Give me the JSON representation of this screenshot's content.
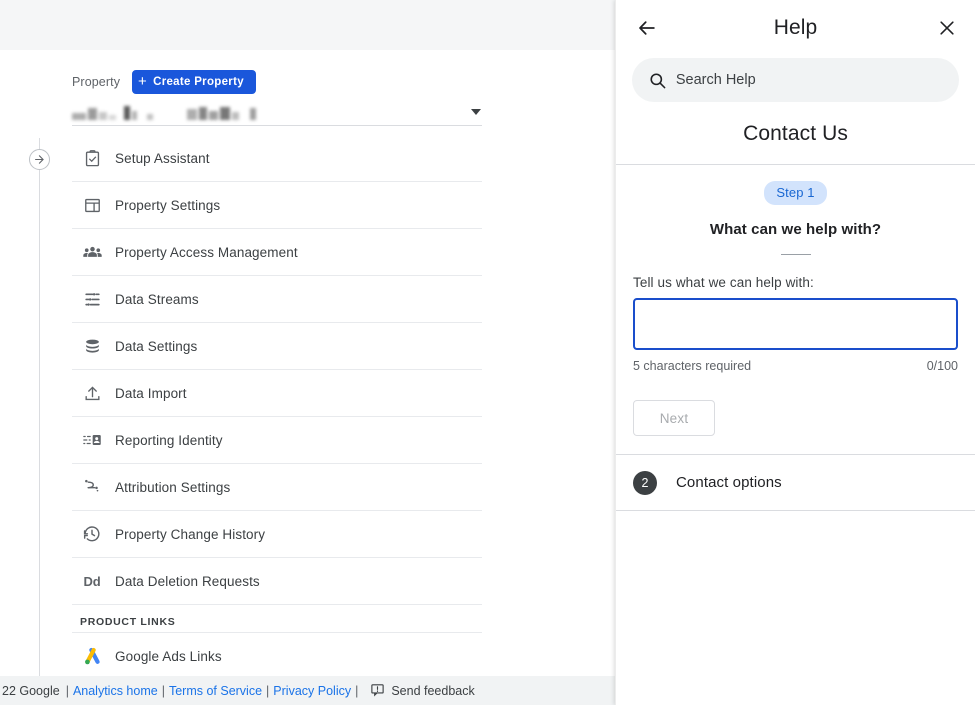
{
  "app": {
    "property_label": "Property",
    "create_property_button": "Create Property",
    "property_selector_value": "",
    "rail_toggle_icon": "arrow-right-circle-icon",
    "menu_items": [
      {
        "label": "Setup Assistant",
        "icon": "clipboard-check-icon"
      },
      {
        "label": "Property Settings",
        "icon": "layout-panel-icon"
      },
      {
        "label": "Property Access Management",
        "icon": "people-group-icon"
      },
      {
        "label": "Data Streams",
        "icon": "tune-sliders-icon"
      },
      {
        "label": "Data Settings",
        "icon": "database-stack-icon"
      },
      {
        "label": "Data Import",
        "icon": "upload-icon"
      },
      {
        "label": "Reporting Identity",
        "icon": "reporting-identity-icon"
      },
      {
        "label": "Attribution Settings",
        "icon": "attribution-path-icon"
      },
      {
        "label": "Property Change History",
        "icon": "history-clock-icon"
      },
      {
        "label": "Data Deletion Requests",
        "icon": "dd-text-icon"
      }
    ],
    "section_heading": "PRODUCT LINKS",
    "product_links": [
      {
        "label": "Google Ads Links",
        "icon": "google-ads-icon"
      }
    ],
    "footer": {
      "copyright": "22 Google",
      "links": [
        {
          "label": "Analytics home"
        },
        {
          "label": "Terms of Service"
        },
        {
          "label": "Privacy Policy"
        }
      ],
      "separator": "|",
      "feedback_label": "Send feedback",
      "feedback_icon": "feedback-icon"
    }
  },
  "help": {
    "back_icon": "arrow-back-icon",
    "title": "Help",
    "close_icon": "close-icon",
    "search": {
      "icon": "search-icon",
      "placeholder": "Search Help",
      "value": ""
    },
    "contact_title": "Contact Us",
    "step": {
      "badge": "Step 1",
      "question": "What can we help with?",
      "field_label": "Tell us what we can help with:",
      "textarea_value": "",
      "helper_text": "5 characters required",
      "counter": "0/100",
      "next_button": "Next"
    },
    "contact_options": {
      "number": "2",
      "label": "Contact options"
    }
  },
  "colors": {
    "accent_blue": "#1a57db",
    "link_blue": "#1a73e8",
    "step_badge_bg": "#d2e3fc",
    "step_badge_text": "#1967d2",
    "focus_border": "#1a4ecb",
    "topbar_gray": "#f5f6f7",
    "footer_gray": "#f1f3f4"
  }
}
